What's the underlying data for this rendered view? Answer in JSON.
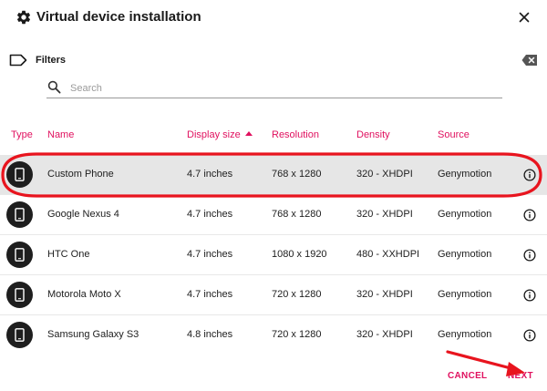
{
  "dialog": {
    "title": "Virtual device installation",
    "title_icon": "gear-icon",
    "close_icon": "close-icon"
  },
  "filters": {
    "label": "Filters",
    "tag_icon": "tag-icon",
    "clear_icon": "backspace-icon"
  },
  "search": {
    "placeholder": "Search",
    "value": ""
  },
  "table": {
    "columns": [
      {
        "key": "type",
        "label": "Type"
      },
      {
        "key": "name",
        "label": "Name"
      },
      {
        "key": "display_size",
        "label": "Display size",
        "sorted": "ascending"
      },
      {
        "key": "resolution",
        "label": "Resolution"
      },
      {
        "key": "density",
        "label": "Density"
      },
      {
        "key": "source",
        "label": "Source"
      }
    ],
    "rows": [
      {
        "type_icon": "phone-icon",
        "name": "Custom Phone",
        "display_size": "4.7 inches",
        "resolution": "768 x 1280",
        "density": "320 - XHDPI",
        "source": "Genymotion",
        "selected": true
      },
      {
        "type_icon": "phone-icon",
        "name": "Google Nexus 4",
        "display_size": "4.7 inches",
        "resolution": "768 x 1280",
        "density": "320 - XHDPI",
        "source": "Genymotion",
        "selected": false
      },
      {
        "type_icon": "phone-icon",
        "name": "HTC One",
        "display_size": "4.7 inches",
        "resolution": "1080 x 1920",
        "density": "480 - XXHDPI",
        "source": "Genymotion",
        "selected": false
      },
      {
        "type_icon": "phone-icon",
        "name": "Motorola Moto X",
        "display_size": "4.7 inches",
        "resolution": "720 x 1280",
        "density": "320 - XHDPI",
        "source": "Genymotion",
        "selected": false
      },
      {
        "type_icon": "phone-icon",
        "name": "Samsung Galaxy S3",
        "display_size": "4.8 inches",
        "resolution": "720 x 1280",
        "density": "320 - XHDPI",
        "source": "Genymotion",
        "selected": false
      }
    ]
  },
  "footer": {
    "cancel_label": "CANCEL",
    "next_label": "NEXT"
  },
  "colors": {
    "accent": "#e0115f",
    "annotation_red": "#e8141e",
    "selected_row": "#e6e6e6",
    "badge": "#1e1e1e"
  }
}
